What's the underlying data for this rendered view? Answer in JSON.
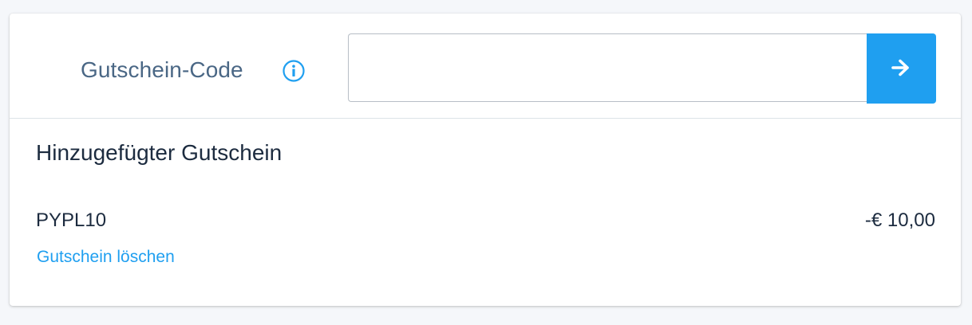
{
  "coupon": {
    "label": "Gutschein-Code",
    "info_icon": "info-circle-icon",
    "input_value": "",
    "input_placeholder": "",
    "submit_icon": "arrow-right-icon",
    "accent_color": "#1f9ff0"
  },
  "applied": {
    "title": "Hinzugefügter Gutschein",
    "code": "PYPL10",
    "amount": "-€ 10,00",
    "remove_label": "Gutschein löschen"
  }
}
